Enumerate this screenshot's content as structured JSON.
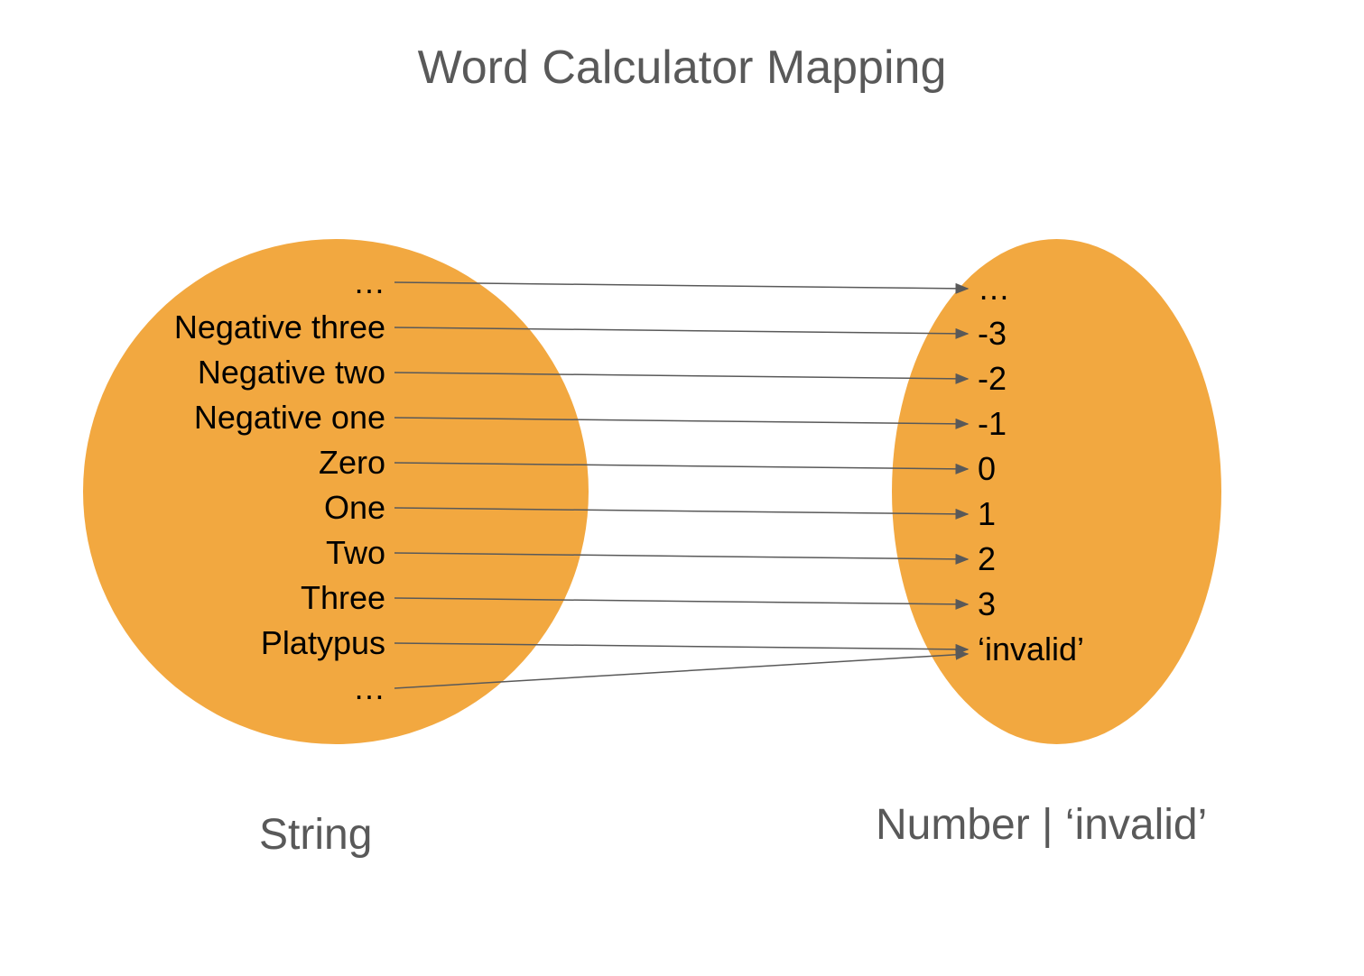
{
  "title": "Word Calculator Mapping",
  "leftLabel": "String",
  "rightLabel": "Number | ‘invalid’",
  "leftItems": {
    "i0": "…",
    "i1": "Negative three",
    "i2": "Negative two",
    "i3": "Negative one",
    "i4": "Zero",
    "i5": "One",
    "i6": "Two",
    "i7": "Three",
    "i8": "Platypus",
    "i9": "…"
  },
  "rightItems": {
    "i0": "…",
    "i1": "-3",
    "i2": "-2",
    "i3": "-1",
    "i4": "0",
    "i5": "1",
    "i6": "2",
    "i7": "3",
    "i8": "‘invalid’"
  },
  "colors": {
    "shape": "#f2a840",
    "title": "#595959",
    "arrow": "#595959"
  }
}
